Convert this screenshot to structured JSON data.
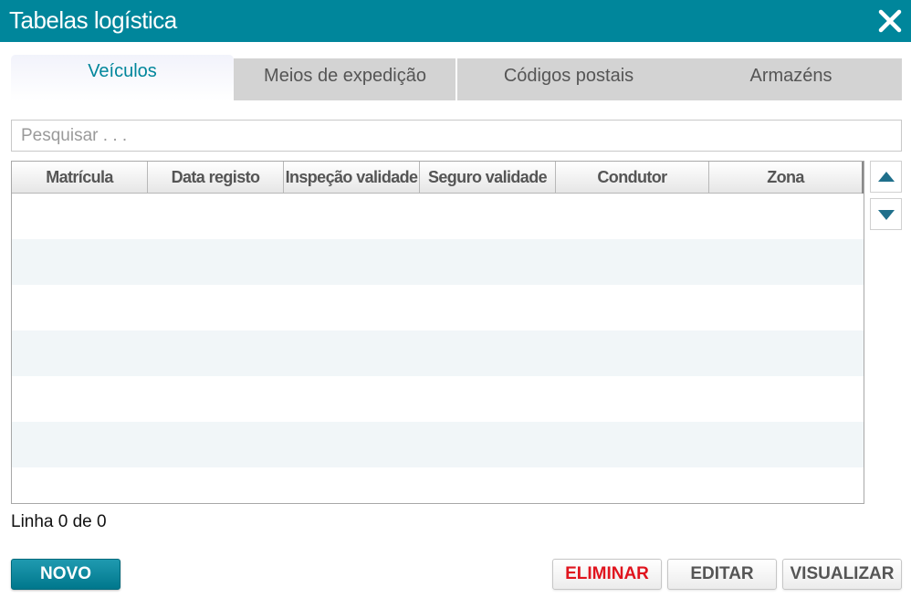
{
  "window": {
    "title": "Tabelas logística"
  },
  "tabs": [
    {
      "label": "Veículos",
      "active": true
    },
    {
      "label": "Meios de expedição",
      "active": false
    },
    {
      "label": "Códigos postais",
      "active": false
    },
    {
      "label": "Armazéns",
      "active": false
    }
  ],
  "search": {
    "placeholder": "Pesquisar . . .",
    "value": ""
  },
  "grid": {
    "columns": [
      "Matrícula",
      "Data registo",
      "Inspeção validade",
      "Seguro validade",
      "Condutor",
      "Zona"
    ],
    "rows": []
  },
  "status": {
    "text": "Linha 0 de 0"
  },
  "buttons": {
    "new": "NOVO",
    "delete": "ELIMINAR",
    "edit": "EDITAR",
    "view": "VISUALIZAR"
  },
  "colors": {
    "accent": "#00869b",
    "delete": "#e0141e",
    "tab_inactive": "#d3d3d3"
  },
  "icons": {
    "close": "close-icon",
    "scroll_up": "arrow-up-icon",
    "scroll_down": "arrow-down-icon"
  }
}
